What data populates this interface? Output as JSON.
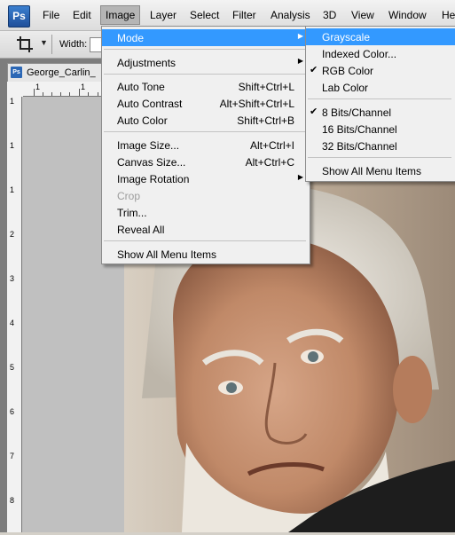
{
  "app": {
    "logo_text": "Ps"
  },
  "menubar": {
    "items": [
      "File",
      "Edit",
      "Image",
      "Layer",
      "Select",
      "Filter",
      "Analysis",
      "3D",
      "View",
      "Window",
      "He"
    ]
  },
  "options": {
    "width_label": "Width:"
  },
  "document": {
    "tab_title": "George_Carlin_",
    "tab_icon": "Ps",
    "ruler_top": [
      "1",
      "1"
    ],
    "ruler_left": [
      "1",
      "1",
      "1",
      "2",
      "3",
      "4",
      "5",
      "6",
      "7",
      "8"
    ]
  },
  "image_menu": {
    "mode": "Mode",
    "adjustments": "Adjustments",
    "auto_tone": {
      "label": "Auto Tone",
      "shortcut": "Shift+Ctrl+L"
    },
    "auto_contrast": {
      "label": "Auto Contrast",
      "shortcut": "Alt+Shift+Ctrl+L"
    },
    "auto_color": {
      "label": "Auto Color",
      "shortcut": "Shift+Ctrl+B"
    },
    "image_size": {
      "label": "Image Size...",
      "shortcut": "Alt+Ctrl+I"
    },
    "canvas_size": {
      "label": "Canvas Size...",
      "shortcut": "Alt+Ctrl+C"
    },
    "image_rotation": "Image Rotation",
    "crop": "Crop",
    "trim": "Trim...",
    "reveal_all": "Reveal All",
    "show_all": "Show All Menu Items"
  },
  "mode_submenu": {
    "grayscale": "Grayscale",
    "indexed_color": "Indexed Color...",
    "rgb_color": "RGB Color",
    "lab_color": "Lab Color",
    "bits8": "8 Bits/Channel",
    "bits16": "16 Bits/Channel",
    "bits32": "32 Bits/Channel",
    "show_all": "Show All Menu Items",
    "checked": [
      "RGB Color",
      "8 Bits/Channel"
    ]
  },
  "colors": {
    "highlight": "#3399ff",
    "menu_bg": "#f0f0f0",
    "canvas_bg": "#c0c0c0"
  }
}
